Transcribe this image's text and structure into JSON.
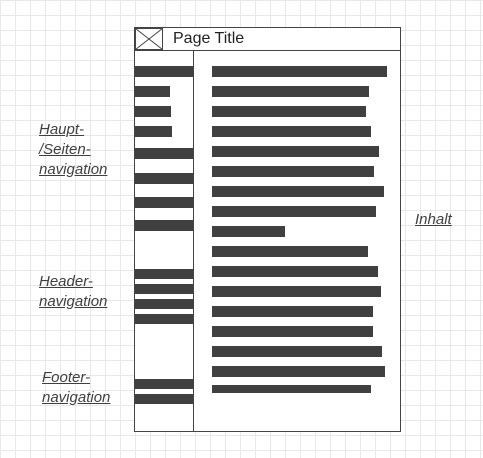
{
  "page_title": "Page Title",
  "annotations": {
    "main_nav": "Haupt-\n/Seiten-\nnavigation",
    "header_nav": "Header-\nnavigation",
    "footer_nav": "Footer-\nnavigation",
    "content": "Inhalt"
  },
  "icons": {
    "title": "image-placeholder-icon"
  }
}
